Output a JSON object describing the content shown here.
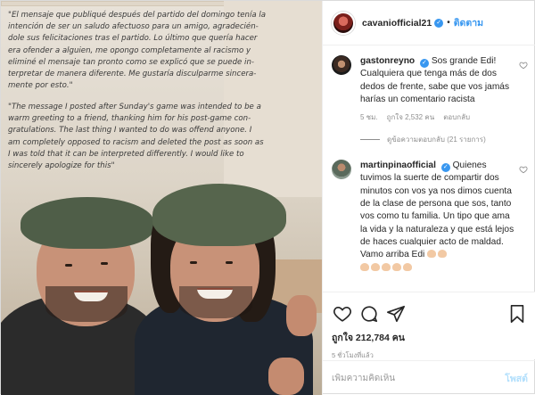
{
  "post": {
    "caption_es": "\"El mensaje que publiqué después del partido del domingo tenía la\nintención de ser un saludo afectuoso para un amigo, agradecién-\ndole sus felicitaciones tras el partido. Lo último que quería hacer\nera ofender a alguien, me opongo completamente al racismo y\neliminé el mensaje tan pronto como se explicó que se puede in-\nterpretar de manera diferente. Me gustaría disculparme sincera-\nmente por esto.\"",
    "caption_en": "\"The message I posted after Sunday's game was intended to be a\nwarm greeting to a friend, thanking him for his post-game con-\ngratulations. The last thing I wanted to do was offend anyone. I\nam completely opposed to racism and deleted the post as soon as\nI was told that it can be interpreted differently. I would like to\nsincerely apologize for this\""
  },
  "header": {
    "username": "cavaniofficial21",
    "separator": "•",
    "follow_label": "ติดตาม"
  },
  "comments": [
    {
      "username": "gastonreyno",
      "text": "Sos grande Edi! Cualquiera que tenga más de dos dedos de frente, sabe que vos jamás harías un comentario racista",
      "time": "5 ชม.",
      "likes": "ถูกใจ 2,532 คน",
      "reply_label": "ตอบกลับ",
      "view_replies": "ดูข้อความตอบกลับ (21 รายการ)"
    },
    {
      "username": "martinpinaofficial",
      "text": "Quienes tuvimos la suerte de compartir dos minutos con vos ya nos dimos cuenta de la clase de persona que sos, tanto vos como tu familia. Un tipo que ama la vida y la naturaleza y que está lejos de haces cualquier acto de maldad. Vamo arriba Edi"
    }
  ],
  "actions": {
    "likes_text": "ถูกใจ 212,784 คน",
    "time_ago": "5 ชั่วโมงที่แล้ว"
  },
  "comment_box": {
    "placeholder": "เพิ่มความคิดเห็น",
    "post_label": "โพสต์"
  },
  "icons": [
    "heart-icon",
    "comment-icon",
    "share-icon",
    "bookmark-icon",
    "verified-icon"
  ]
}
